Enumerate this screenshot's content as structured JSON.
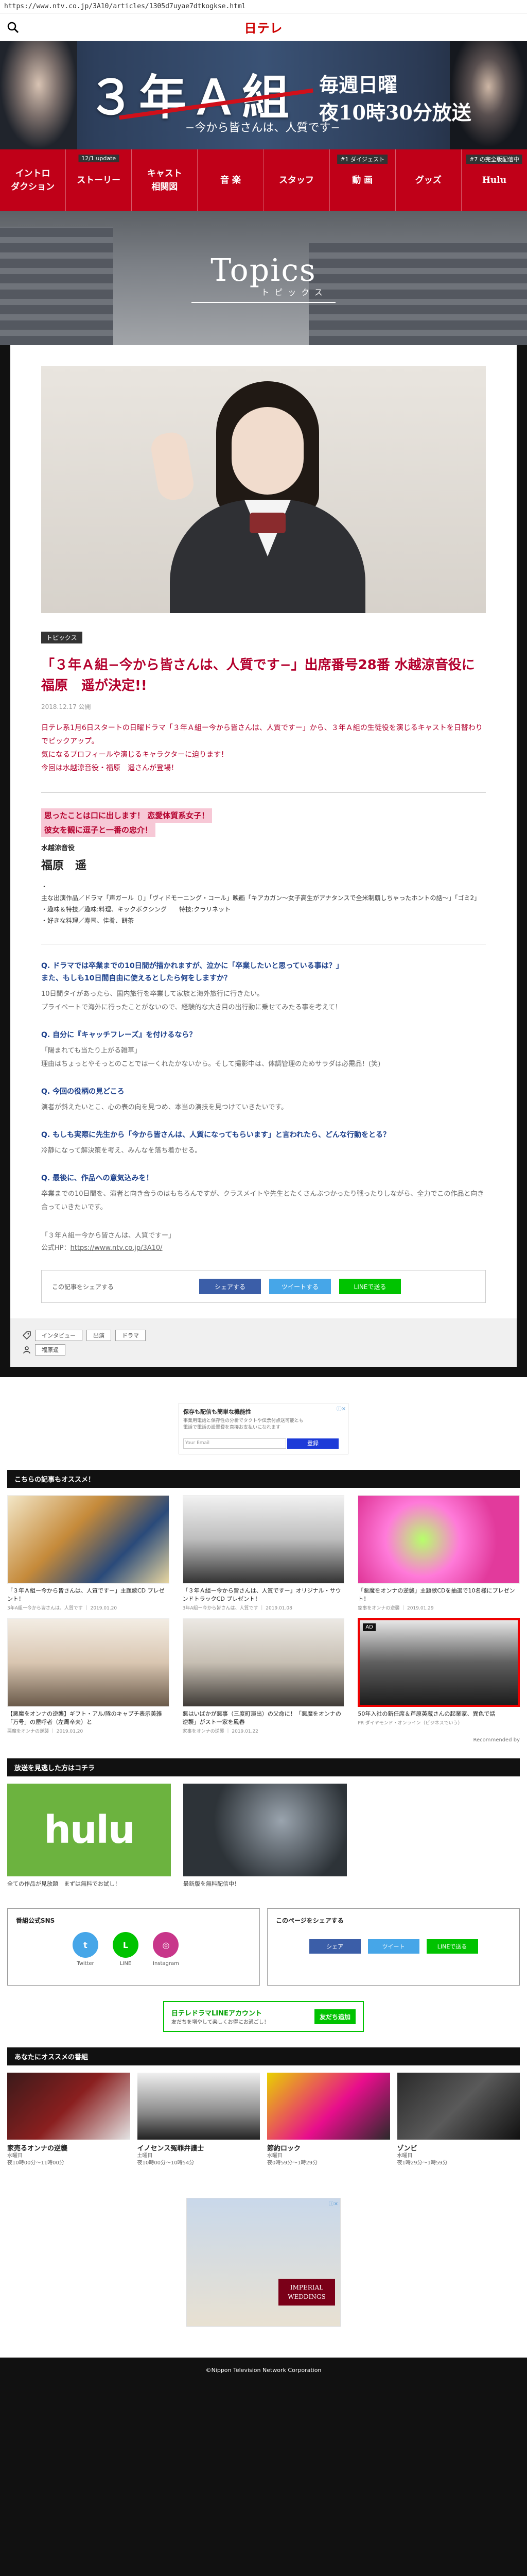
{
  "url": "https://www.ntv.co.jp/3A10/articles/1305d7uyae7dtkogkse.html",
  "header": {
    "logo_main": "日テ",
    "logo_accent": "レ"
  },
  "hero": {
    "title": "３年Ａ組",
    "subtitle": "−今から皆さんは、人質です−",
    "air_line1": "毎週日曜",
    "air_line2": "夜10時30分放送"
  },
  "nav": [
    {
      "label": "イントロ\nダクション",
      "badge": ""
    },
    {
      "label": "ストーリー",
      "badge": "12/1 update"
    },
    {
      "label": "キャスト\n相関図",
      "badge": ""
    },
    {
      "label": "音 楽",
      "badge": ""
    },
    {
      "label": "スタッフ",
      "badge": ""
    },
    {
      "label": "動 画",
      "badge": "#1 ダイジェスト"
    },
    {
      "label": "グッズ",
      "badge": ""
    },
    {
      "label": "Hulu",
      "badge": "#7 の完全版配信中"
    }
  ],
  "topics": {
    "en": "Topics",
    "ja": "トピックス"
  },
  "article": {
    "tag": "トピックス",
    "headline": "「３年Ａ組−今から皆さんは、人質です−」出席番号28番 水越涼音役に 福原　遥が決定!!",
    "date": "2018.12.17 公開",
    "lead_1": "日テレ系1月6日スタートの日曜ドラマ「３年Ａ組ー今から皆さんは、人質ですー」から、３年Ａ組の生徒役を演じるキャストを日替わりでピックアップ。",
    "lead_2": "気になるプロフィールや演じるキャラクターに迫ります！",
    "lead_3": "今回は水越涼音役・福原　遥さんが登場！",
    "char_1": "思ったことは口に出します！ 恋愛体質系女子！",
    "char_2": "彼女を観に逗子と一番の忠介！",
    "role": "水越涼音役",
    "name": "福原　遥",
    "profile": [
      "主な出演作品／ドラマ「声ガール（）」「ヴィドモーニング・コール」映画「キアカガン〜女子高生がアナタンスで全米制覇しちゃったホントの話〜」「ゴミ2」",
      "趣味＆特技／趣味:料理、キックボクシング　　特技:クラリネット",
      "好きな料理／寿司、佳肴、餅茶"
    ],
    "qa": [
      {
        "q": "Q. ドラマでは卒業までの10日間が描かれますが、泣かに「卒業したいと思っている事は？」\nまた、もしも10日間自由に使えるとしたら何をしますか？",
        "a": "10日間タイがあったら、国内旅行を卒業して家族と海外旅行に行きたい。\nプライベートで海外に行ったことがないので、経験的な大き目の出行動に乗せてみたる事を考えて！"
      },
      {
        "q": "Q. 自分に『キャッチフレーズ』を付けるなら？",
        "a": "「陽まれても当たり上がる雑草」\n理由はちょっとやそっとのことでは一くれたかないから。そして撮影中は、体調管理のためサラダは必需品！(笑)"
      },
      {
        "q": "Q. 今回の役柄の見どころ",
        "a": "演者が斜えたいとこ、心の表の向を見つめ、本当の演技を見つけていきたいです。"
      },
      {
        "q": "Q. もしも実際に先生から「今から皆さんは、人質になってもらいます」と言われたら、どんな行動をとる？",
        "a": "冷静になって解決策を考え、みんなを落ち着かせる。"
      },
      {
        "q": "Q. 最後に、作品への意気込みを！",
        "a": "卒業までの10日間を、演者と向き合うのはもちろんですが、クラスメイトや先生とたくさんぶつかったり戦ったりしながら、全力でこの作品と向き合っていきたいです。"
      }
    ],
    "official_1": "「３年Ａ組ー今から皆さんは、人質ですー」",
    "official_2_label": "公式HP：",
    "official_2_link": "https://www.ntv.co.jp/3A10/",
    "share_label": "この記事をシェアする",
    "share_fb": "シェアする",
    "share_tw": "ツイートする",
    "share_line": "LINEで送る"
  },
  "tags": {
    "row1": [
      "インタビュー",
      "出演",
      "ドラマ"
    ],
    "row2": [
      "福原遥"
    ]
  },
  "ad1": {
    "title": "保存も配信も簡単な機能性",
    "line1": "事業用電話と保存性の分析でタクトや伝票付点送可能とも",
    "line2": "電話で電話の設置費を直接お支払いになれます",
    "placeholder": "Your Email",
    "button": "登録",
    "mark": "ⓘ✕"
  },
  "recommend": {
    "heading": "こちらの記事もオススメ！",
    "items": [
      {
        "title": "「３年Ａ組ー今から皆さんは、人質ですー」主題歌CD プレゼント！",
        "sub": "3年A組ー今から皆さんは、人質です ｜ 2019.01.20"
      },
      {
        "title": "「３年Ａ組ー今から皆さんは、人質ですー」オリジナル・サウンドトラックCD プレゼント！",
        "sub": "3年A組ー今から皆さんは、人質です ｜ 2019.01.08"
      },
      {
        "title": "「悪魔をオンナの逆襲」主題歌CDを抽選で10名様にプレゼント！",
        "sub": "家事をオンナの逆襲 ｜ 2019.01.29"
      },
      {
        "title": "【悪魔をオンナの逆襲】ギフト・アル/隊のキャプチ表示美雑「万号」の屋呼者（左周卒夫）と",
        "sub": "悪魔をオンナの逆襲 ｜ 2019.01.20"
      },
      {
        "title": "悪はいばかが悪事（三度町演出）の父命に！「悪魔をオンナの逆襲」がスト一家を鳳春",
        "sub": "家事をオンナの逆襲 ｜ 2019.01.22"
      },
      {
        "title": "50年入社の新任席＆芦原英蔵さんの起業家、異色で話",
        "sub": "PR ダイヤモンド・オンライン（ビジネスでいう）"
      }
    ],
    "ad_badge": "AD",
    "credit": "Recommended by"
  },
  "watch": {
    "heading": "放送を見逃した方はコチラ",
    "hulu_logo": "hulu",
    "hulu_caption": "全ての作品が見放題　まずは無料でお試し！",
    "tver_caption": "最新版を無料配信中！"
  },
  "sns": {
    "official_heading": "番組公式SNS",
    "icons": [
      {
        "label": "Twitter",
        "glyph": "t",
        "color": "#46a6e8"
      },
      {
        "label": "LINE",
        "glyph": "L",
        "color": "#00c300"
      },
      {
        "label": "Instagram",
        "glyph": "◎",
        "color": "#c8368a"
      }
    ],
    "share_heading": "このページをシェアする",
    "share_fb": "シェア",
    "share_tw": "ツイート",
    "share_line": "LINEで送る"
  },
  "line_banner": {
    "t1": "日テレドラマLINEアカウント",
    "t2": "友だちを増やして楽しくお得にお過ごし！",
    "button": "友だち追加"
  },
  "programs": {
    "heading": "あなたにオススメの番組",
    "items": [
      {
        "title": "家売るオンナの逆襲",
        "d1": "水曜日",
        "d2": "夜10時00分〜11時00分"
      },
      {
        "title": "イノセンス冤罪弁護士",
        "d1": "土曜日",
        "d2": "夜10時00分〜10時54分"
      },
      {
        "title": "節約ロック",
        "d1": "水曜日",
        "d2": "夜0時59分〜1時29分"
      },
      {
        "title": "ゾンビ",
        "d1": "水曜日",
        "d2": "夜1時29分〜1時59分"
      }
    ]
  },
  "ad2": {
    "brand": "IMPERIAL WEDDINGS",
    "mark": "ⓘ✕"
  },
  "footer": "©Nippon Television Network Corporation"
}
